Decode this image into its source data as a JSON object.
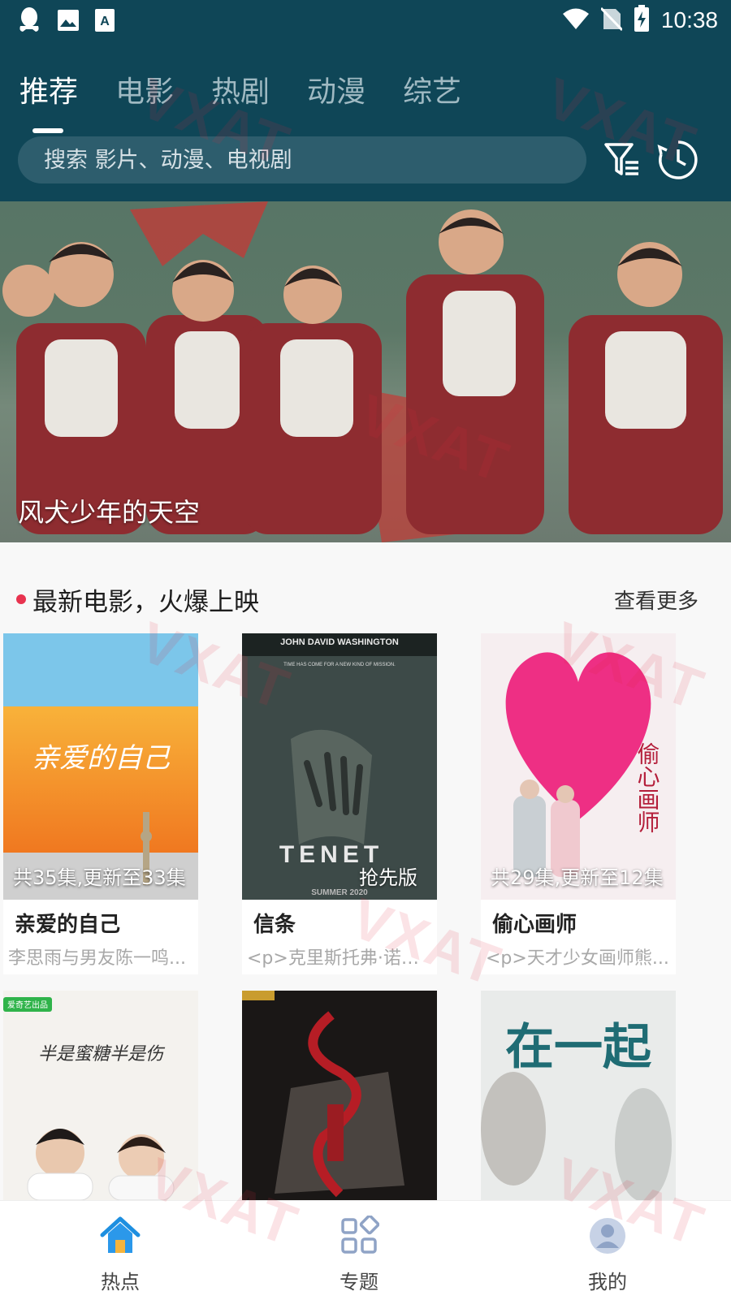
{
  "status_bar": {
    "time": "10:38",
    "icons": [
      "qq-icon",
      "image-icon",
      "font-a-icon",
      "wifi-icon",
      "no-sim-icon",
      "battery-charging-icon"
    ]
  },
  "tabs": [
    {
      "label": "推荐",
      "active": true
    },
    {
      "label": "电影",
      "active": false
    },
    {
      "label": "热剧",
      "active": false
    },
    {
      "label": "动漫",
      "active": false
    },
    {
      "label": "综艺",
      "active": false
    }
  ],
  "search": {
    "placeholder": "搜索 影片、动漫、电视剧"
  },
  "banner": {
    "title": "风犬少年的天空"
  },
  "section": {
    "title": "最新电影，火爆上映",
    "more": "查看更多"
  },
  "cards": [
    {
      "title": "亲爱的自己",
      "badge": "共35集,更新至33集",
      "desc": "李思雨与男友陈一鸣...",
      "poster_text": "亲爱的自己"
    },
    {
      "title": "信条",
      "badge": "抢先版",
      "desc": "<p>克里斯托弗·诺兰...",
      "poster_text": "TENET",
      "poster_top": "JOHN DAVID WASHINGTON",
      "poster_line": "TIME HAS COME FOR A NEW KIND OF MISSION.",
      "poster_bottom": "SUMMER 2020"
    },
    {
      "title": "偷心画师",
      "badge": "共29集,更新至12集",
      "desc": "<p>天才少女画师熊...",
      "poster_text": "偷心画师"
    },
    {
      "title": "",
      "badge": "",
      "desc": "",
      "poster_text": "半是蜜糖半是伤",
      "poster_tag": "爱奇艺出品"
    },
    {
      "title": "",
      "badge": "",
      "desc": "",
      "poster_text": ""
    },
    {
      "title": "",
      "badge": "",
      "desc": "",
      "poster_text": "在一起"
    }
  ],
  "bottom_nav": [
    {
      "label": "热点",
      "icon": "home-icon",
      "active": true
    },
    {
      "label": "专题",
      "icon": "grid-icon",
      "active": false
    },
    {
      "label": "我的",
      "icon": "user-icon",
      "active": false
    }
  ],
  "watermark": "VXAT",
  "colors": {
    "header": "#0f4657",
    "accent": "#e8334f",
    "nav_active": "#1e8fe0"
  }
}
